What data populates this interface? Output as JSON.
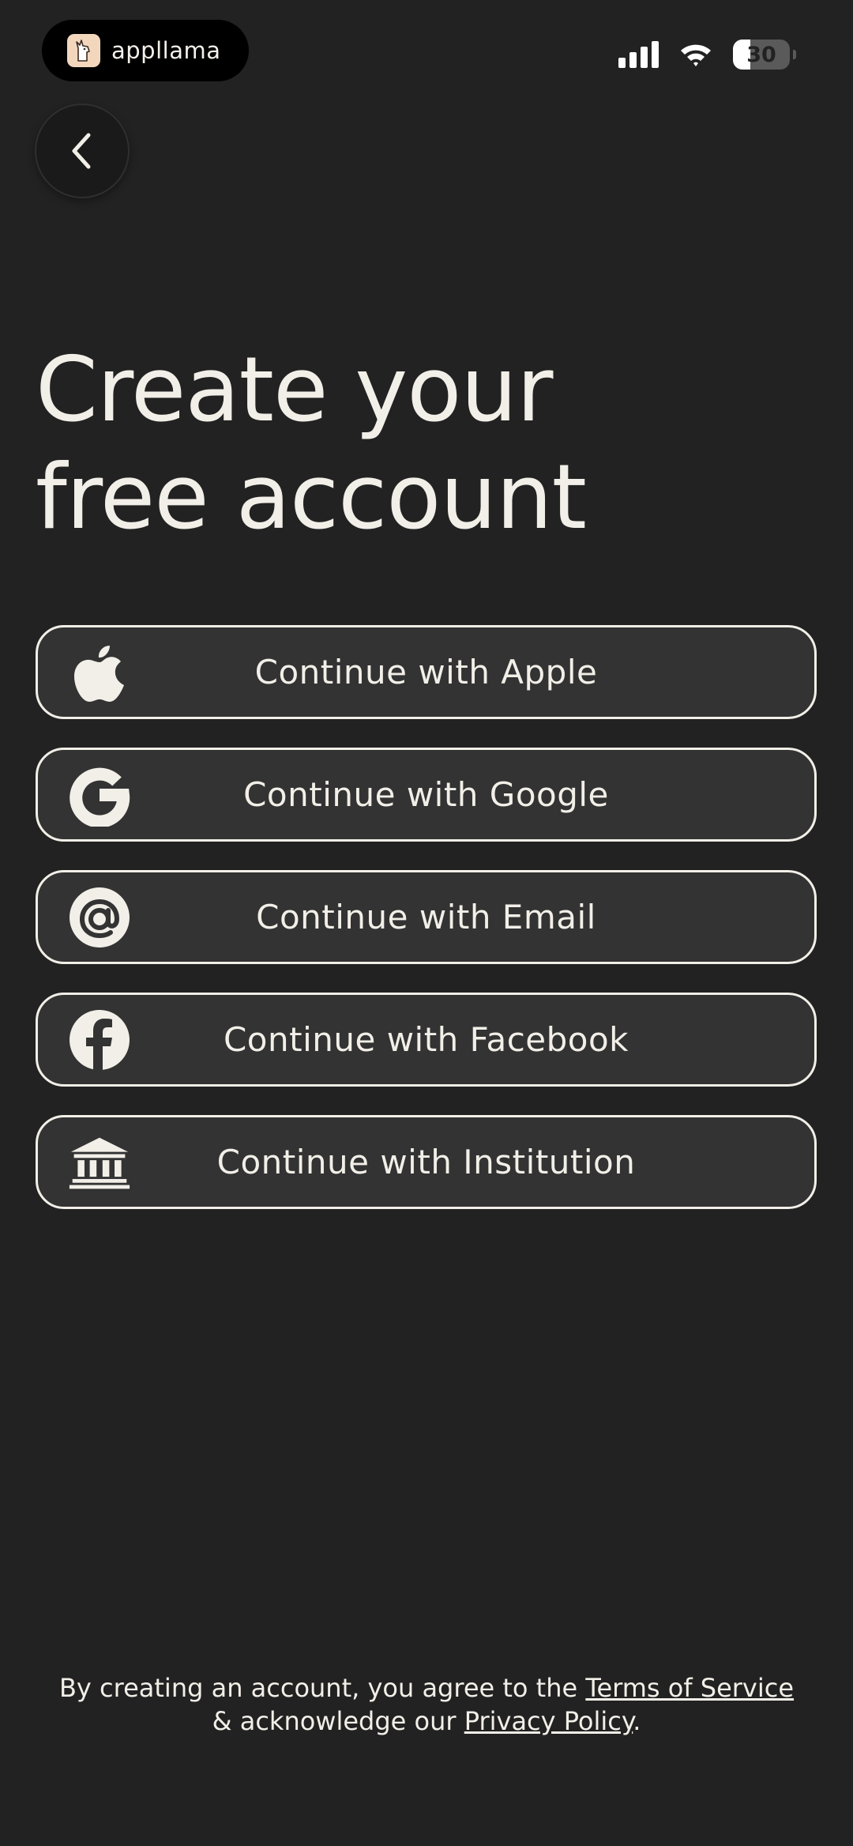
{
  "status_bar": {
    "app_name": "appllama",
    "battery_level": "30",
    "battery_fraction": 0.3,
    "icons": [
      "cellular-signal-icon",
      "wifi-icon",
      "battery-icon"
    ]
  },
  "nav": {
    "back_icon": "chevron-left-icon"
  },
  "title": {
    "line1": "Create your",
    "line2": "free account"
  },
  "auth_buttons": [
    {
      "label": "Continue with Apple",
      "icon": "apple-icon"
    },
    {
      "label": "Continue with Google",
      "icon": "google-icon"
    },
    {
      "label": "Continue with Email",
      "icon": "at-sign-icon"
    },
    {
      "label": "Continue with Facebook",
      "icon": "facebook-icon"
    },
    {
      "label": "Continue with Institution",
      "icon": "institution-icon"
    }
  ],
  "footer": {
    "text_before": "By creating an account, you agree to the ",
    "terms_link": "Terms of Service",
    "text_middle": " & acknowledge our ",
    "privacy_link": "Privacy Policy",
    "text_after": "."
  },
  "colors": {
    "background": "#222222",
    "button_fill": "#333333",
    "button_border": "#f2efe8",
    "text": "#f2efe8"
  }
}
